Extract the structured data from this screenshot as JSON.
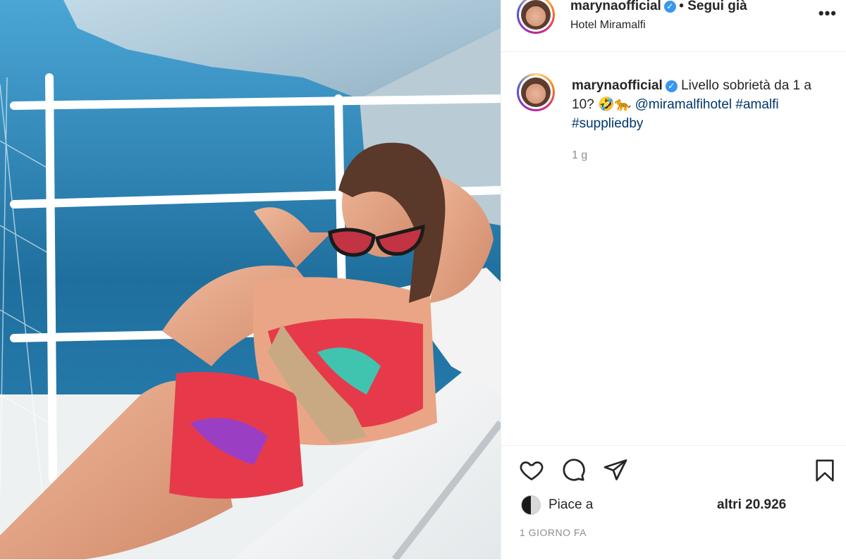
{
  "post": {
    "username": "marynaofficial",
    "follow_status": "• Segui già",
    "location": "Hotel Miramalfi",
    "more_label": "•••",
    "verified_mark": "✓"
  },
  "caption": {
    "username": "marynaofficial",
    "text": "Livello sobrietà da 1 a 10? 🤣🐆",
    "mention": "@miramalfihotel",
    "hashtags": [
      "#amalfi",
      "#suppliedby"
    ],
    "time": "1 g"
  },
  "actions": {
    "icons": [
      "heart-icon",
      "comment-icon",
      "share-icon",
      "bookmark-icon"
    ],
    "likes_prefix": "Piace a",
    "likes_count": "altri 20.926",
    "date": "1 GIORNO FA"
  },
  "colors": {
    "link": "#00376b",
    "verified": "#3897f0",
    "muted": "#8e8e8e"
  }
}
